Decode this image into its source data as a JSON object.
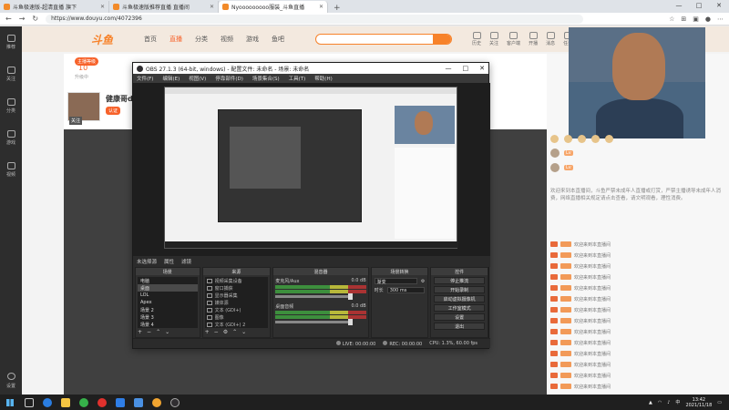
{
  "browser": {
    "tabs": [
      {
        "label": "斗鱼极速版-超清直播 旗下",
        "active": false
      },
      {
        "label": "斗鱼极速版推荐直播 直播间",
        "active": false
      },
      {
        "label": "Nyooooooooo服装_斗鱼直播",
        "active": true
      }
    ],
    "url": "https://www.douyu.com/4072396",
    "win_controls": [
      "—",
      "□",
      "✕"
    ]
  },
  "site": {
    "logo": "斗鱼",
    "nav": [
      "首页",
      "直播",
      "分类",
      "视频",
      "游戏",
      "鱼吧"
    ],
    "active_nav": "直播",
    "header_icons": [
      "历史",
      "关注",
      "客户端",
      "开播",
      "消息",
      "任务"
    ]
  },
  "rail": {
    "items": [
      "推荐",
      "关注",
      "分类",
      "游戏",
      "视频"
    ],
    "bottom": "设置"
  },
  "room": {
    "level_badge": "主播等级",
    "level_num": "10",
    "level_sub": "升级中",
    "anchor_name": "健康哥da",
    "anchor_tag": "关注",
    "anchor_badge": "认证"
  },
  "obs": {
    "title": "OBS 27.1.3 (64-bit, windows) - 配置文件: 未命名 - 场景: 未命名",
    "menu": [
      "文件(F)",
      "编辑(E)",
      "视图(V)",
      "停靠部件(D)",
      "场景集合(S)",
      "工具(T)",
      "帮助(H)"
    ],
    "scenes_label": "未选择源",
    "scenes_buttons": [
      "属性",
      "滤镜"
    ],
    "docks": {
      "scenes": {
        "title": "场景",
        "items": [
          "电脑",
          "桌面",
          "LOL",
          "Apex",
          "场景 2",
          "场景 3",
          "场景 4"
        ],
        "selected": 1
      },
      "sources": {
        "title": "来源",
        "items": [
          "视频采集设备",
          "窗口捕获",
          "显示器采集",
          "媒体源",
          "文本 (GDI+)",
          "图像",
          "文本 (GDI+) 2"
        ]
      },
      "mixer": {
        "title": "混音器",
        "channels": [
          {
            "name": "麦克风/Aux",
            "db": "0.0 dB"
          },
          {
            "name": "桌面音频",
            "db": "0.0 dB"
          }
        ]
      },
      "transitions": {
        "title": "场景转换",
        "type": "渐变",
        "duration_label": "时长",
        "duration": "300 ms"
      },
      "controls": {
        "title": "控件",
        "buttons": [
          "停止推流",
          "开始录制",
          "启动虚拟摄像机",
          "工作室模式",
          "设置",
          "退出"
        ]
      }
    },
    "status": {
      "live": "LIVE: 00:00:00",
      "rec": "REC: 00:00:00",
      "cpu": "CPU: 1.3%, 60.00 fps"
    }
  },
  "chat": {
    "notice": "欢迎来到本直播间，斗鱼严禁未成年人直播或打赏，严禁主播诱导未成年人消费，网络直播相关规定请点击查看，请文明观看，理性消费。",
    "lines": [
      "欢迎来到本直播间",
      "欢迎来到本直播间",
      "欢迎来到本直播间",
      "欢迎来到本直播间",
      "欢迎来到本直播间",
      "欢迎来到本直播间",
      "欢迎来到本直播间",
      "欢迎来到本直播间",
      "欢迎来到本直播间",
      "欢迎来到本直播间",
      "欢迎来到本直播间",
      "欢迎来到本直播间",
      "欢迎来到本直播间",
      "欢迎来到本直播间"
    ]
  },
  "taskbar": {
    "time": "13:42",
    "date": "2021/11/18",
    "lang": "中"
  }
}
